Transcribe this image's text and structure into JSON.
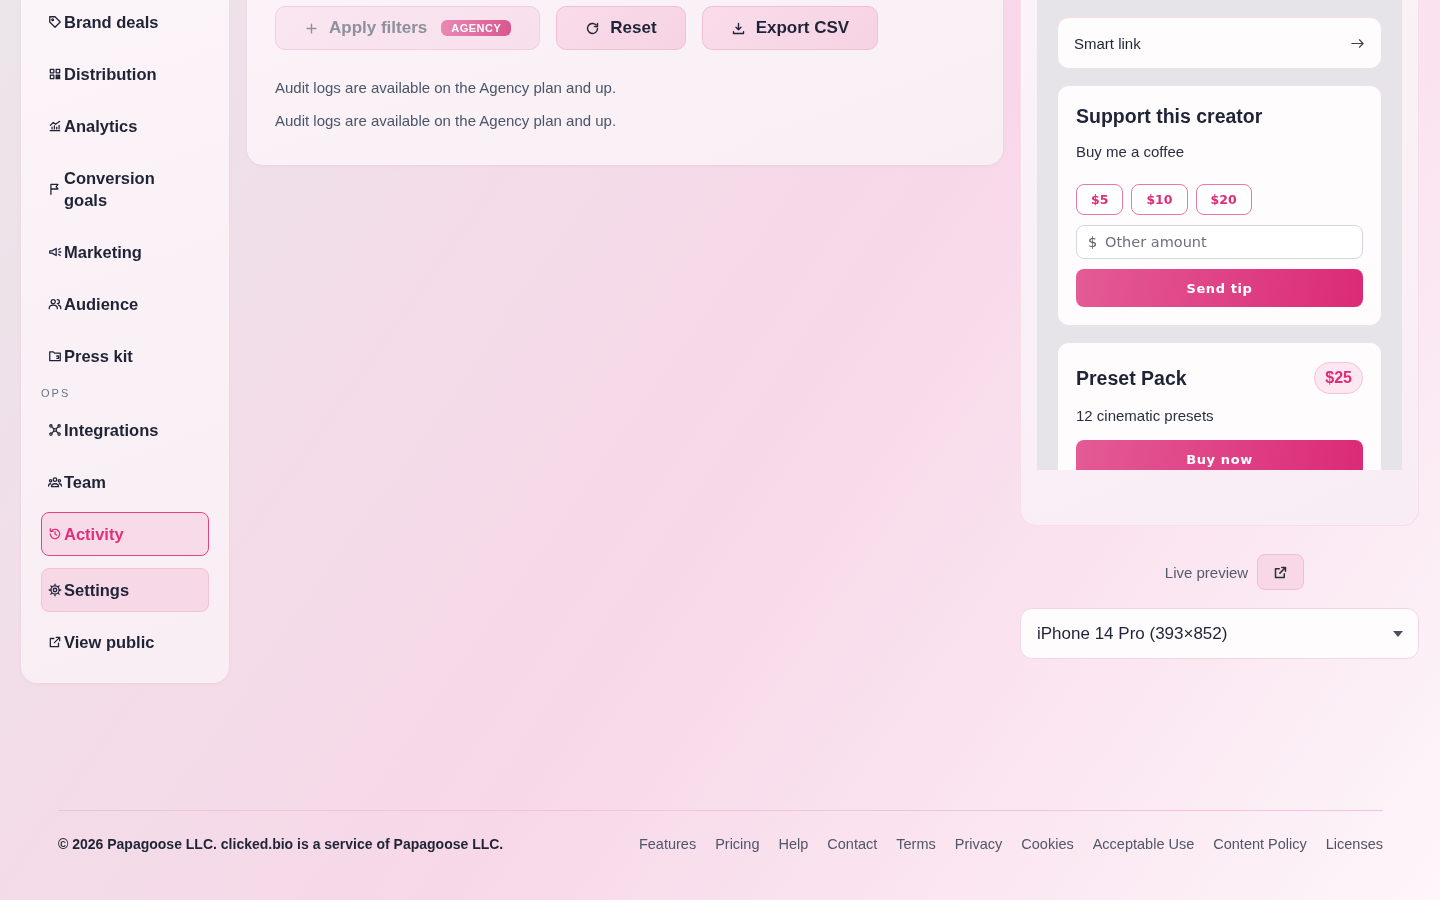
{
  "sidebar": {
    "groups": [
      {
        "items": [
          {
            "label": "Brand deals",
            "selected": false,
            "highlighted": false
          },
          {
            "label": "Distribution",
            "selected": false,
            "highlighted": false
          },
          {
            "label": "Analytics",
            "selected": false,
            "highlighted": false
          },
          {
            "label": "Conversion goals",
            "selected": false,
            "highlighted": false
          },
          {
            "label": "Marketing",
            "selected": false,
            "highlighted": false
          },
          {
            "label": "Audience",
            "selected": false,
            "highlighted": false
          },
          {
            "label": "Press kit",
            "selected": false,
            "highlighted": false
          }
        ]
      },
      {
        "heading": "OPS",
        "items": [
          {
            "label": "Integrations",
            "selected": false,
            "highlighted": false
          },
          {
            "label": "Team",
            "selected": false,
            "highlighted": false
          },
          {
            "label": "Activity",
            "selected": true,
            "highlighted": false
          }
        ]
      },
      {
        "items": [
          {
            "label": "Settings",
            "selected": false,
            "highlighted": true
          },
          {
            "label": "View public",
            "selected": false,
            "highlighted": false
          }
        ]
      }
    ]
  },
  "toolbar": {
    "buttons": [
      {
        "label": "Apply filters",
        "badge": "AGENCY",
        "disabled": true
      },
      {
        "label": "Reset",
        "disabled": false
      },
      {
        "label": "Export CSV",
        "disabled": false
      }
    ]
  },
  "notices": [
    "Audit logs are available on the Agency plan and up.",
    "Audit logs are available on the Agency plan and up."
  ],
  "preview": {
    "smart_link": "Smart link",
    "tip_card": {
      "title": "Support this creator",
      "subtitle": "Buy me a coffee",
      "amounts": [
        "$5",
        "$10",
        "$20"
      ],
      "currency": "$",
      "placeholder": "Other amount",
      "button": "Send tip"
    },
    "product_card": {
      "title": "Preset Pack",
      "price": "$25",
      "description": "12 cinematic presets",
      "button": "Buy now"
    },
    "label": "Live preview",
    "device": "iPhone 14 Pro (393×852)"
  },
  "footer": {
    "copyright": "© 2026 Papagoose LLC. clicked.bio is a service of Papagoose LLC.",
    "links": [
      "Features",
      "Pricing",
      "Help",
      "Contact",
      "Terms",
      "Privacy",
      "Cookies",
      "Acceptable Use",
      "Content Policy",
      "Licenses"
    ]
  }
}
